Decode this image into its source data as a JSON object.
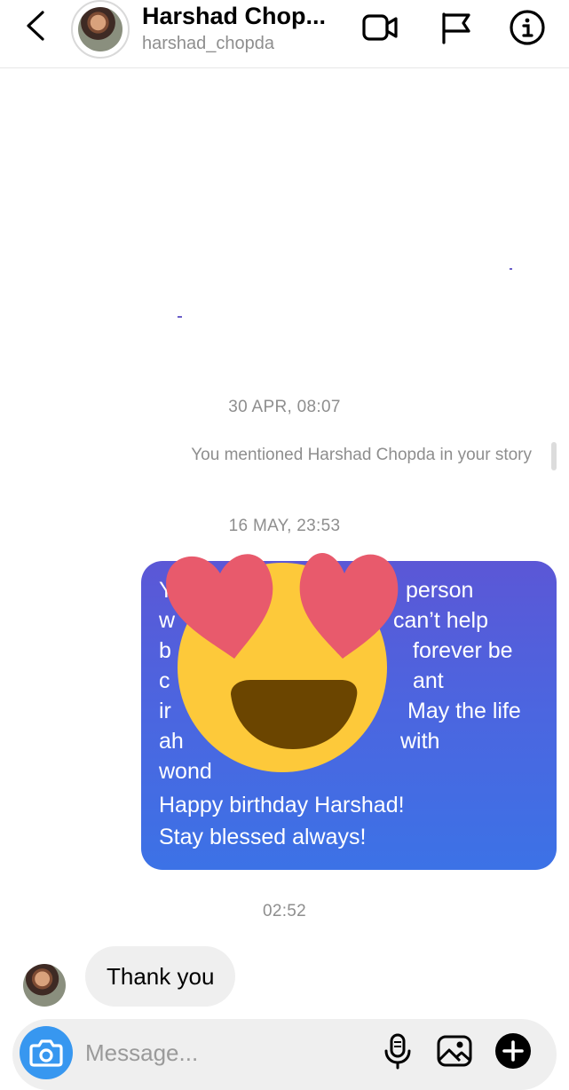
{
  "header": {
    "title": "Harshad Chop...",
    "username": "harshad_chopda",
    "icons": [
      "back-chevron-icon",
      "video-call-icon",
      "flag-icon",
      "info-icon"
    ]
  },
  "thread": {
    "timestamp_1": "30 APR, 08:07",
    "mention_text": "You mentioned Harshad Chopda in your story",
    "timestamp_2": "16 MAY, 23:53",
    "message_lines": [
      "Y",
      "w",
      "b",
      "c",
      "ir",
      "ah",
      "wond",
      "Happy birthday Harshad!",
      "Stay blessed always!"
    ],
    "message_right_fragments": [
      "person",
      "can’t help",
      "forever be",
      "ant",
      "May the life",
      "with"
    ],
    "overlay_emoji": "smiling-face-with-heart-eyes",
    "timestamp_3": "02:52",
    "reply_text": "Thank you"
  },
  "composer": {
    "placeholder": "Message...",
    "icons": [
      "camera-icon",
      "microphone-icon",
      "gallery-icon",
      "add-icon"
    ]
  },
  "colors": {
    "bubble_gradient_top": "#5b57d6",
    "bubble_gradient_bottom": "#3c72e6",
    "camera_button": "#3797f0",
    "emoji_face": "#fdc93a",
    "emoji_hearts": "#e85a6c"
  }
}
